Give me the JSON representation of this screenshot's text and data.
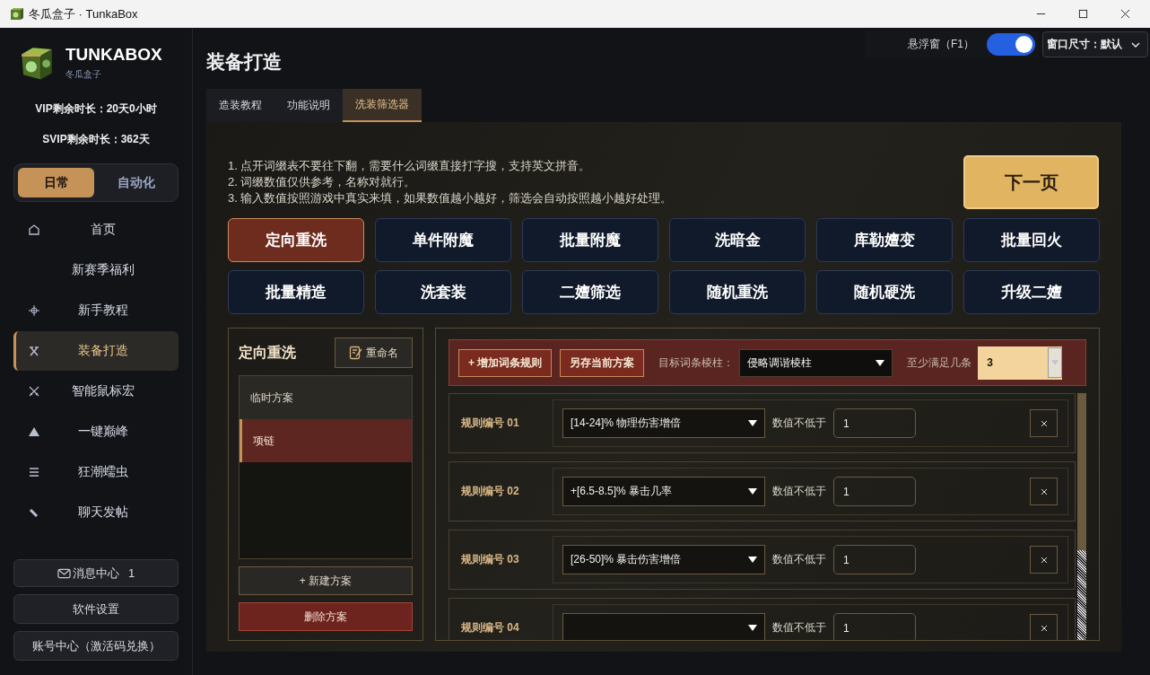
{
  "window": {
    "title": "冬瓜盒子 · TunkaBox"
  },
  "sidebar": {
    "brand": "TUNKABOX",
    "subtitle": "冬瓜盒子",
    "vip": "VIP剩余时长：20天0小时",
    "svip": "SVIP剩余时长：362天",
    "modes": [
      {
        "label": "日常",
        "selected": true
      },
      {
        "label": "自动化",
        "selected": false
      }
    ],
    "items": [
      {
        "label": "首页",
        "selected": false
      },
      {
        "label": "新赛季福利",
        "selected": false
      },
      {
        "label": "新手教程",
        "selected": false
      },
      {
        "label": "装备打造",
        "selected": true
      },
      {
        "label": "智能鼠标宏",
        "selected": false
      },
      {
        "label": "一键巅峰",
        "selected": false
      },
      {
        "label": "狂潮蠕虫",
        "selected": false
      },
      {
        "label": "聊天发帖",
        "selected": false
      }
    ],
    "messages": {
      "label": "消息中心",
      "count": "1"
    },
    "settings": "软件设置",
    "account": "账号中心（激活码兑换）"
  },
  "header": {
    "float_label": "悬浮窗（F1）",
    "float_on": true,
    "window_size": "窗口尺寸：默认"
  },
  "page": {
    "title": "装备打造",
    "tabs": [
      {
        "label": "造装教程",
        "selected": false
      },
      {
        "label": "功能说明",
        "selected": false
      },
      {
        "label": "洗装筛选器",
        "selected": true
      }
    ],
    "notes": [
      "1. 点开词缀表不要往下翻，需要什么词缀直接打字搜，支持英文拼音。",
      "2. 词缀数值仅供参考，名称对就行。",
      "3. 输入数值按照游戏中真实来填，如果数值越小越好，筛选会自动按照越小越好处理。"
    ],
    "next_button": "下一页",
    "modes": [
      {
        "label": "定向重洗",
        "selected": true
      },
      {
        "label": "单件附魔",
        "selected": false
      },
      {
        "label": "批量附魔",
        "selected": false
      },
      {
        "label": "洗暗金",
        "selected": false
      },
      {
        "label": "库勒嬗变",
        "selected": false
      },
      {
        "label": "批量回火",
        "selected": false
      },
      {
        "label": "批量精造",
        "selected": false
      },
      {
        "label": "洗套装",
        "selected": false
      },
      {
        "label": "二嬗筛选",
        "selected": false
      },
      {
        "label": "随机重洗",
        "selected": false
      },
      {
        "label": "随机硬洗",
        "selected": false
      },
      {
        "label": "升级二嬗",
        "selected": false
      }
    ]
  },
  "plans": {
    "title": "定向重洗",
    "rename": "重命名",
    "items": [
      {
        "label": "临时方案",
        "selected": false
      },
      {
        "label": "项链",
        "selected": true
      }
    ],
    "new_button": "+  新建方案",
    "delete_button": "删除方案"
  },
  "rules": {
    "add_button": "+  增加词条规则",
    "save_button": "另存当前方案",
    "target_label": "目标词条棱柱：",
    "target": "侵略调谐棱柱",
    "min_label": "至少满足几条",
    "min": "3",
    "rows": [
      {
        "label": "规则编号 01",
        "affix": "[14-24]% 物理伤害增倍",
        "condition": "数值不低于",
        "value": "1"
      },
      {
        "label": "规则编号 02",
        "affix": "+[6.5-8.5]% 暴击几率",
        "condition": "数值不低于",
        "value": "1"
      },
      {
        "label": "规则编号 03",
        "affix": "[26-50]% 暴击伤害增倍",
        "condition": "数值不低于",
        "value": "1"
      },
      {
        "label": "规则编号 04",
        "condition": "数值不低于",
        "value": "1"
      }
    ]
  }
}
